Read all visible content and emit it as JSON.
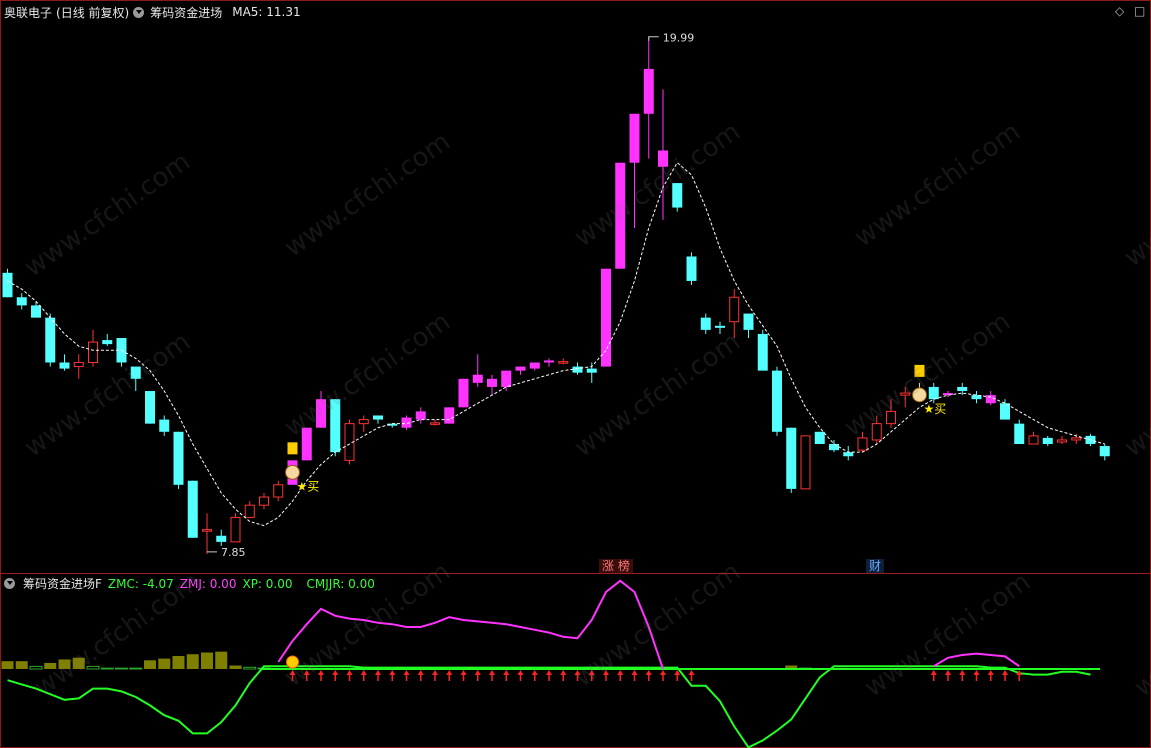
{
  "header": {
    "stock_name": "奥联电子",
    "period": "(日线 前复权)",
    "indicator_name": "筹码资金进场",
    "ma_label": "MA5: 11.31"
  },
  "corner_icons": [
    "diamond-icon",
    "square-icon"
  ],
  "subpanel": {
    "name": "筹码资金进场F",
    "values": [
      {
        "label": "ZMC: -4.07",
        "color": "#33ff33"
      },
      {
        "label": "ZMJ: 0.00",
        "color": "#ff44ff"
      },
      {
        "label": "XP: 0.00",
        "color": "#33ff33"
      },
      {
        "label": "CMJJR: 0.00",
        "color": "#33ff33"
      }
    ]
  },
  "annotations": {
    "high_label": "19.99",
    "low_label": "7.85",
    "buy_label_1": "买",
    "buy_label_2": "买",
    "tag_limit_up": "涨 榜",
    "tag_finance": "财"
  },
  "watermark": "www.cfchi.com",
  "colors": {
    "up_red": "#ff3333",
    "down_cyan": "#54ffff",
    "magenta": "#ff33ff",
    "green": "#22ff22",
    "olive": "#808000"
  },
  "chart_data": {
    "type": "candlestick",
    "price_range": [
      7.85,
      19.99
    ],
    "candles": [
      {
        "o": 14.2,
        "h": 14.3,
        "l": 13.6,
        "c": 13.6,
        "k": "d"
      },
      {
        "o": 13.6,
        "h": 13.7,
        "l": 13.3,
        "c": 13.4,
        "k": "d"
      },
      {
        "o": 13.4,
        "h": 13.5,
        "l": 13.1,
        "c": 13.1,
        "k": "d"
      },
      {
        "o": 13.1,
        "h": 13.2,
        "l": 11.9,
        "c": 12.0,
        "k": "d"
      },
      {
        "o": 12.0,
        "h": 12.2,
        "l": 11.8,
        "c": 11.85,
        "k": "d"
      },
      {
        "o": 11.9,
        "h": 12.2,
        "l": 11.6,
        "c": 12.0,
        "k": "u"
      },
      {
        "o": 12.0,
        "h": 12.8,
        "l": 11.9,
        "c": 12.5,
        "k": "u"
      },
      {
        "o": 12.55,
        "h": 12.7,
        "l": 12.4,
        "c": 12.45,
        "k": "d"
      },
      {
        "o": 12.6,
        "h": 12.6,
        "l": 11.9,
        "c": 12.0,
        "k": "d"
      },
      {
        "o": 11.9,
        "h": 11.9,
        "l": 11.3,
        "c": 11.6,
        "k": "d"
      },
      {
        "o": 11.3,
        "h": 11.3,
        "l": 10.5,
        "c": 10.5,
        "k": "d"
      },
      {
        "o": 10.6,
        "h": 10.7,
        "l": 10.2,
        "c": 10.3,
        "k": "d"
      },
      {
        "o": 10.3,
        "h": 10.3,
        "l": 8.9,
        "c": 9.0,
        "k": "d"
      },
      {
        "o": 9.1,
        "h": 9.1,
        "l": 7.7,
        "c": 7.7,
        "k": "d"
      },
      {
        "o": 7.9,
        "h": 8.3,
        "l": 7.3,
        "c": 7.9,
        "k": "u"
      },
      {
        "o": 7.75,
        "h": 7.9,
        "l": 7.5,
        "c": 7.6,
        "k": "d"
      },
      {
        "o": 7.6,
        "h": 8.3,
        "l": 7.6,
        "c": 8.2,
        "k": "u"
      },
      {
        "o": 8.2,
        "h": 8.6,
        "l": 8.2,
        "c": 8.5,
        "k": "u"
      },
      {
        "o": 8.5,
        "h": 8.8,
        "l": 8.4,
        "c": 8.7,
        "k": "u"
      },
      {
        "o": 8.7,
        "h": 9.1,
        "l": 8.6,
        "c": 9.0,
        "k": "u"
      },
      {
        "o": 9.0,
        "h": 9.6,
        "l": 9.0,
        "c": 9.6,
        "k": "m"
      },
      {
        "o": 9.6,
        "h": 10.4,
        "l": 9.6,
        "c": 10.4,
        "k": "m"
      },
      {
        "o": 10.4,
        "h": 11.3,
        "l": 10.4,
        "c": 11.1,
        "k": "m"
      },
      {
        "o": 11.1,
        "h": 11.1,
        "l": 9.7,
        "c": 9.8,
        "k": "d"
      },
      {
        "o": 9.6,
        "h": 10.6,
        "l": 9.5,
        "c": 10.5,
        "k": "u"
      },
      {
        "o": 10.5,
        "h": 10.7,
        "l": 10.3,
        "c": 10.6,
        "k": "u"
      },
      {
        "o": 10.7,
        "h": 10.7,
        "l": 10.5,
        "c": 10.6,
        "k": "d"
      },
      {
        "o": 10.5,
        "h": 10.5,
        "l": 10.4,
        "c": 10.45,
        "k": "d"
      },
      {
        "o": 10.4,
        "h": 10.7,
        "l": 10.35,
        "c": 10.65,
        "k": "m"
      },
      {
        "o": 10.6,
        "h": 10.9,
        "l": 10.5,
        "c": 10.8,
        "k": "m"
      },
      {
        "o": 10.5,
        "h": 10.6,
        "l": 10.45,
        "c": 10.52,
        "k": "u"
      },
      {
        "o": 10.5,
        "h": 10.9,
        "l": 10.5,
        "c": 10.9,
        "k": "m"
      },
      {
        "o": 10.9,
        "h": 11.6,
        "l": 10.9,
        "c": 11.6,
        "k": "m"
      },
      {
        "o": 11.5,
        "h": 12.2,
        "l": 11.4,
        "c": 11.7,
        "k": "m"
      },
      {
        "o": 11.4,
        "h": 11.7,
        "l": 11.2,
        "c": 11.6,
        "k": "m"
      },
      {
        "o": 11.4,
        "h": 11.8,
        "l": 11.3,
        "c": 11.8,
        "k": "m"
      },
      {
        "o": 11.8,
        "h": 11.9,
        "l": 11.7,
        "c": 11.9,
        "k": "m"
      },
      {
        "o": 11.85,
        "h": 12.0,
        "l": 11.8,
        "c": 12.0,
        "k": "m"
      },
      {
        "o": 12.0,
        "h": 12.1,
        "l": 11.9,
        "c": 12.05,
        "k": "m"
      },
      {
        "o": 12.0,
        "h": 12.1,
        "l": 11.95,
        "c": 12.02,
        "k": "u"
      },
      {
        "o": 11.9,
        "h": 12.0,
        "l": 11.7,
        "c": 11.75,
        "k": "d"
      },
      {
        "o": 11.85,
        "h": 12.0,
        "l": 11.5,
        "c": 11.75,
        "k": "d"
      },
      {
        "o": 11.9,
        "h": 14.3,
        "l": 11.9,
        "c": 14.3,
        "k": "m"
      },
      {
        "o": 14.3,
        "h": 16.9,
        "l": 14.3,
        "c": 16.9,
        "k": "m"
      },
      {
        "o": 16.9,
        "h": 18.1,
        "l": 15.3,
        "c": 18.1,
        "k": "m"
      },
      {
        "o": 18.1,
        "h": 19.99,
        "l": 17.0,
        "c": 19.2,
        "k": "m"
      },
      {
        "o": 17.2,
        "h": 18.7,
        "l": 15.5,
        "c": 16.8,
        "k": "m"
      },
      {
        "o": 16.4,
        "h": 16.4,
        "l": 15.7,
        "c": 15.8,
        "k": "d"
      },
      {
        "o": 14.6,
        "h": 14.7,
        "l": 13.9,
        "c": 14.0,
        "k": "d"
      },
      {
        "o": 13.1,
        "h": 13.2,
        "l": 12.7,
        "c": 12.8,
        "k": "d"
      },
      {
        "o": 12.9,
        "h": 13.0,
        "l": 12.7,
        "c": 12.85,
        "k": "d"
      },
      {
        "o": 13.0,
        "h": 13.8,
        "l": 12.6,
        "c": 13.6,
        "k": "u"
      },
      {
        "o": 13.2,
        "h": 13.2,
        "l": 12.6,
        "c": 12.8,
        "k": "d"
      },
      {
        "o": 12.7,
        "h": 12.8,
        "l": 11.8,
        "c": 11.8,
        "k": "d"
      },
      {
        "o": 11.8,
        "h": 11.9,
        "l": 10.2,
        "c": 10.3,
        "k": "d"
      },
      {
        "o": 10.4,
        "h": 10.4,
        "l": 8.8,
        "c": 8.9,
        "k": "d"
      },
      {
        "o": 8.9,
        "h": 10.2,
        "l": 8.9,
        "c": 10.2,
        "k": "u"
      },
      {
        "o": 10.3,
        "h": 10.3,
        "l": 10.0,
        "c": 10.0,
        "k": "d"
      },
      {
        "o": 10.0,
        "h": 10.1,
        "l": 9.8,
        "c": 9.85,
        "k": "d"
      },
      {
        "o": 9.8,
        "h": 9.95,
        "l": 9.6,
        "c": 9.7,
        "k": "d"
      },
      {
        "o": 9.85,
        "h": 10.3,
        "l": 9.8,
        "c": 10.15,
        "k": "u"
      },
      {
        "o": 10.1,
        "h": 10.7,
        "l": 10.0,
        "c": 10.5,
        "k": "u"
      },
      {
        "o": 10.5,
        "h": 11.1,
        "l": 10.4,
        "c": 10.8,
        "k": "u"
      },
      {
        "o": 11.2,
        "h": 11.4,
        "l": 10.9,
        "c": 11.25,
        "k": "u"
      },
      {
        "o": 11.3,
        "h": 11.5,
        "l": 11.1,
        "c": 11.25,
        "k": "y"
      },
      {
        "o": 11.4,
        "h": 11.5,
        "l": 11.0,
        "c": 11.1,
        "k": "d"
      },
      {
        "o": 11.2,
        "h": 11.3,
        "l": 11.15,
        "c": 11.25,
        "k": "m"
      },
      {
        "o": 11.4,
        "h": 11.5,
        "l": 11.2,
        "c": 11.3,
        "k": "d"
      },
      {
        "o": 11.2,
        "h": 11.3,
        "l": 11.0,
        "c": 11.1,
        "k": "d"
      },
      {
        "o": 11.2,
        "h": 11.3,
        "l": 10.95,
        "c": 11.0,
        "k": "m"
      },
      {
        "o": 11.0,
        "h": 11.1,
        "l": 10.6,
        "c": 10.6,
        "k": "d"
      },
      {
        "o": 10.5,
        "h": 10.6,
        "l": 10.0,
        "c": 10.0,
        "k": "d"
      },
      {
        "o": 10.0,
        "h": 10.3,
        "l": 10.0,
        "c": 10.2,
        "k": "u"
      },
      {
        "o": 10.15,
        "h": 10.2,
        "l": 9.95,
        "c": 10.0,
        "k": "d"
      },
      {
        "o": 10.05,
        "h": 10.2,
        "l": 10.0,
        "c": 10.1,
        "k": "u"
      },
      {
        "o": 10.1,
        "h": 10.25,
        "l": 10.0,
        "c": 10.15,
        "k": "u"
      },
      {
        "o": 10.2,
        "h": 10.25,
        "l": 9.95,
        "c": 10.0,
        "k": "d"
      },
      {
        "o": 9.95,
        "h": 10.0,
        "l": 9.6,
        "c": 9.7,
        "k": "d"
      }
    ],
    "ma5": [
      14.0,
      13.8,
      13.5,
      13.1,
      12.7,
      12.4,
      12.3,
      12.3,
      12.3,
      12.1,
      11.8,
      11.3,
      10.7,
      10.0,
      9.4,
      8.8,
      8.4,
      8.1,
      8.0,
      8.2,
      8.6,
      9.1,
      9.5,
      9.8,
      10.0,
      10.2,
      10.4,
      10.5,
      10.5,
      10.6,
      10.6,
      10.6,
      10.8,
      11.0,
      11.2,
      11.4,
      11.5,
      11.6,
      11.7,
      11.8,
      11.85,
      11.9,
      12.3,
      13.0,
      14.0,
      15.3,
      16.3,
      16.9,
      16.6,
      15.8,
      14.8,
      14.0,
      13.4,
      12.9,
      12.4,
      11.6,
      10.9,
      10.4,
      10.0,
      9.8,
      9.8,
      10.0,
      10.3,
      10.6,
      10.9,
      11.1,
      11.2,
      11.25,
      11.2,
      11.15,
      11.0,
      10.8,
      10.6,
      10.4,
      10.3,
      10.2,
      10.1,
      10.0
    ],
    "zmj": [
      null,
      null,
      null,
      null,
      null,
      null,
      null,
      null,
      null,
      null,
      null,
      null,
      null,
      null,
      null,
      null,
      null,
      null,
      null,
      0.5,
      2.0,
      3.2,
      4.3,
      3.8,
      3.6,
      3.5,
      3.3,
      3.2,
      3.0,
      3.0,
      3.3,
      3.7,
      3.5,
      3.4,
      3.3,
      3.2,
      3.0,
      2.8,
      2.6,
      2.3,
      2.2,
      3.5,
      5.5,
      6.3,
      5.5,
      3.0,
      0.0,
      null,
      null,
      null,
      null,
      null,
      null,
      null,
      null,
      null,
      null,
      null,
      null,
      null,
      null,
      null,
      null,
      null,
      null,
      0.2,
      0.8,
      1.0,
      1.1,
      1.0,
      0.9,
      0.2,
      null,
      null,
      null,
      null,
      null,
      null
    ],
    "zmc": [
      -0.8,
      -1.1,
      -1.4,
      -1.8,
      -2.2,
      -2.1,
      -1.4,
      -1.4,
      -1.6,
      -2.0,
      -2.6,
      -3.3,
      -3.7,
      -4.6,
      -4.6,
      -3.8,
      -2.6,
      -1.0,
      0.2,
      0.2,
      0.2,
      0.2,
      0.2,
      0.2,
      0.2,
      0.1,
      0.1,
      0.1,
      0.1,
      0.1,
      0.1,
      0.1,
      0.1,
      0.1,
      0.1,
      0.1,
      0.1,
      0.1,
      0.1,
      0.1,
      0.1,
      0.1,
      0.1,
      0.1,
      0.1,
      0.1,
      0.1,
      0.1,
      -1.2,
      -1.2,
      -2.3,
      -4.1,
      -5.6,
      -5.1,
      -4.4,
      -3.6,
      -2.1,
      -0.6,
      0.2,
      0.2,
      0.2,
      0.2,
      0.2,
      0.2,
      0.2,
      0.2,
      0.2,
      0.2,
      0.2,
      0.1,
      0.1,
      -0.3,
      -0.4,
      -0.4,
      -0.2,
      -0.2,
      -0.4
    ],
    "volume_bars": [
      0.9,
      0.9,
      0.3,
      0.7,
      1.1,
      1.3,
      0.3,
      0.1,
      0.1,
      0.1,
      1.0,
      1.2,
      1.5,
      1.7,
      1.9,
      2.0,
      0.4,
      0.2,
      0.1,
      0,
      0,
      0,
      0,
      0,
      0,
      0,
      0,
      0,
      0,
      0,
      0,
      0,
      0,
      0,
      0,
      0,
      0,
      0,
      0,
      0,
      0,
      0,
      0,
      0,
      0,
      0,
      0,
      0,
      0,
      0,
      0,
      0,
      0,
      0,
      0,
      0.4,
      0.1,
      0,
      0,
      0,
      0,
      0,
      0,
      0,
      0,
      0,
      0,
      0,
      0,
      0,
      0,
      0,
      0,
      0,
      0,
      0,
      0,
      0
    ],
    "signal_arrows_range": [
      20,
      48
    ],
    "signal_arrows_range_2": [
      65,
      71
    ]
  }
}
